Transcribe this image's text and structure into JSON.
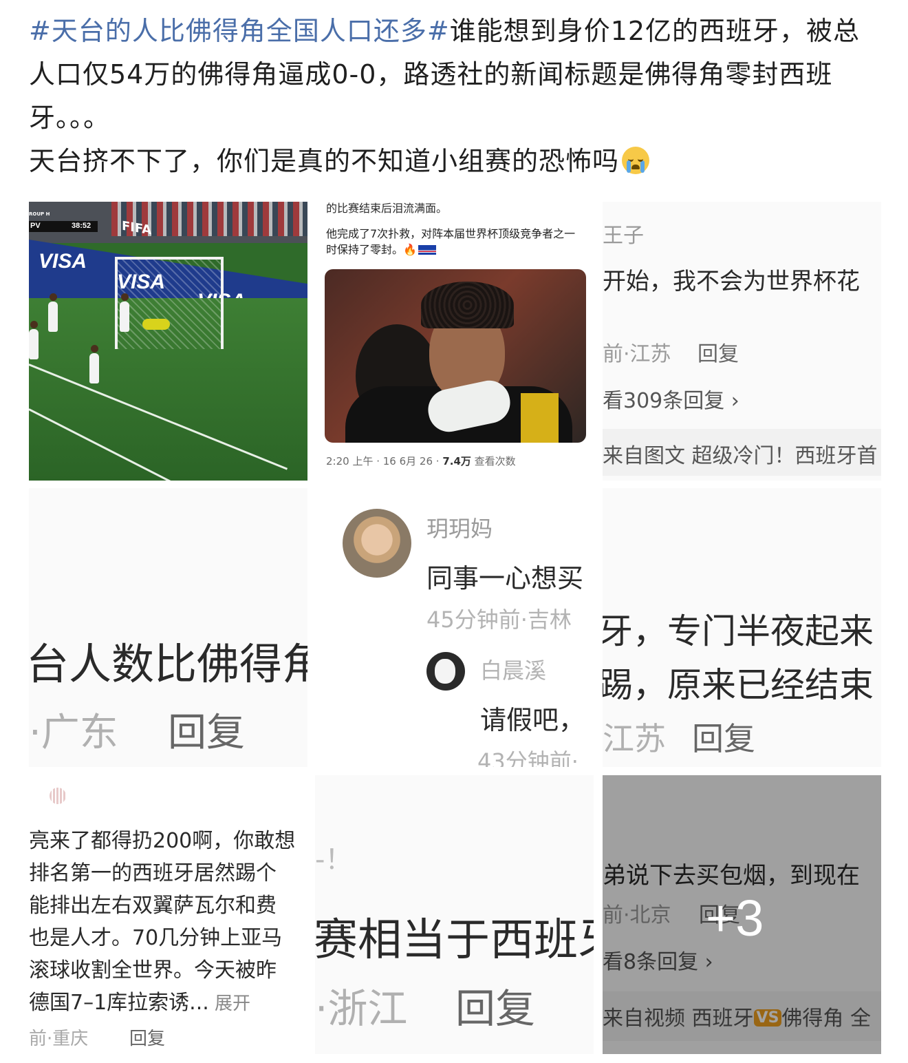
{
  "post": {
    "hashtag": "#天台的人比佛得角全国人口还多#",
    "text": "谁能想到身价12亿的西班牙，被总人口仅54万的佛得角逼成0-0，路透社的新闻标题是佛得角零封西班牙。。。",
    "text2": "天台挤不下了，你们是真的不知道小组赛的恐怖吗",
    "emoji": "crying-face-icon"
  },
  "images": {
    "img1": {
      "group_label": "ROUP H",
      "team_code": "PV",
      "clock": "38:52",
      "fifa": "FIFA",
      "ad": "VISA"
    },
    "img2": {
      "top_cut_text": "的比赛结束后泪流满面。",
      "tweet_text": "他完成了7次扑救，对阵本届世界杯顶级竞争者之一时保持了零封。🔥",
      "meta_time": "2:20 上午 · 16 6月 26 · ",
      "meta_views": "7.4万",
      "meta_views_label": " 查看次数"
    },
    "img3": {
      "name": "王子",
      "comment": "开始，我不会为世界杯花",
      "meta_location": "前·江苏",
      "reply": "回复",
      "view_replies": "看309条回复 ›",
      "source": "来自图文 超级冷门！西班牙首"
    },
    "img4": {
      "comment": "台人数比佛得角",
      "location": "·广东",
      "reply": "回复"
    },
    "img5": {
      "user1_name": "玥玥妈",
      "user1_comment": "同事一心想买",
      "user1_meta": "45分钟前·吉林",
      "user2_name": "白晨溪",
      "user2_comment": "请假吧，",
      "user2_meta": "43分钟前·"
    },
    "img6": {
      "line1": "牙，专门半夜起来",
      "line2": "踢，原来已经结束",
      "location": "江苏",
      "reply": "回复"
    },
    "img7": {
      "lines": [
        "亮来了都得扔200啊，你敢想",
        "排名第一的西班牙居然踢个",
        " 能排出左右双翼萨瓦尔和费",
        "也是人才。70几分钟上亚马",
        "滚球收割全世界。今天被昨",
        "德国7–1库拉索诱..."
      ],
      "expand": " 展开",
      "meta": "前·重庆",
      "reply": "回复"
    },
    "img8": {
      "cut_text": "-！",
      "comment": "赛相当于西班牙",
      "location": "·浙江",
      "reply": "回复"
    },
    "img9": {
      "comment": "弟说下去买包烟，到现在",
      "meta": "前·北京",
      "reply": "回复",
      "view_replies": "看8条回复 ›",
      "source_prefix": "来自视频 西班牙",
      "vs": "VS",
      "source_suffix": "佛得角 全",
      "more_count": "+3"
    }
  },
  "colors": {
    "hashtag": "#4a6ea9",
    "meta_grey": "#9a9a9a",
    "vs_badge": "#f0a020"
  }
}
